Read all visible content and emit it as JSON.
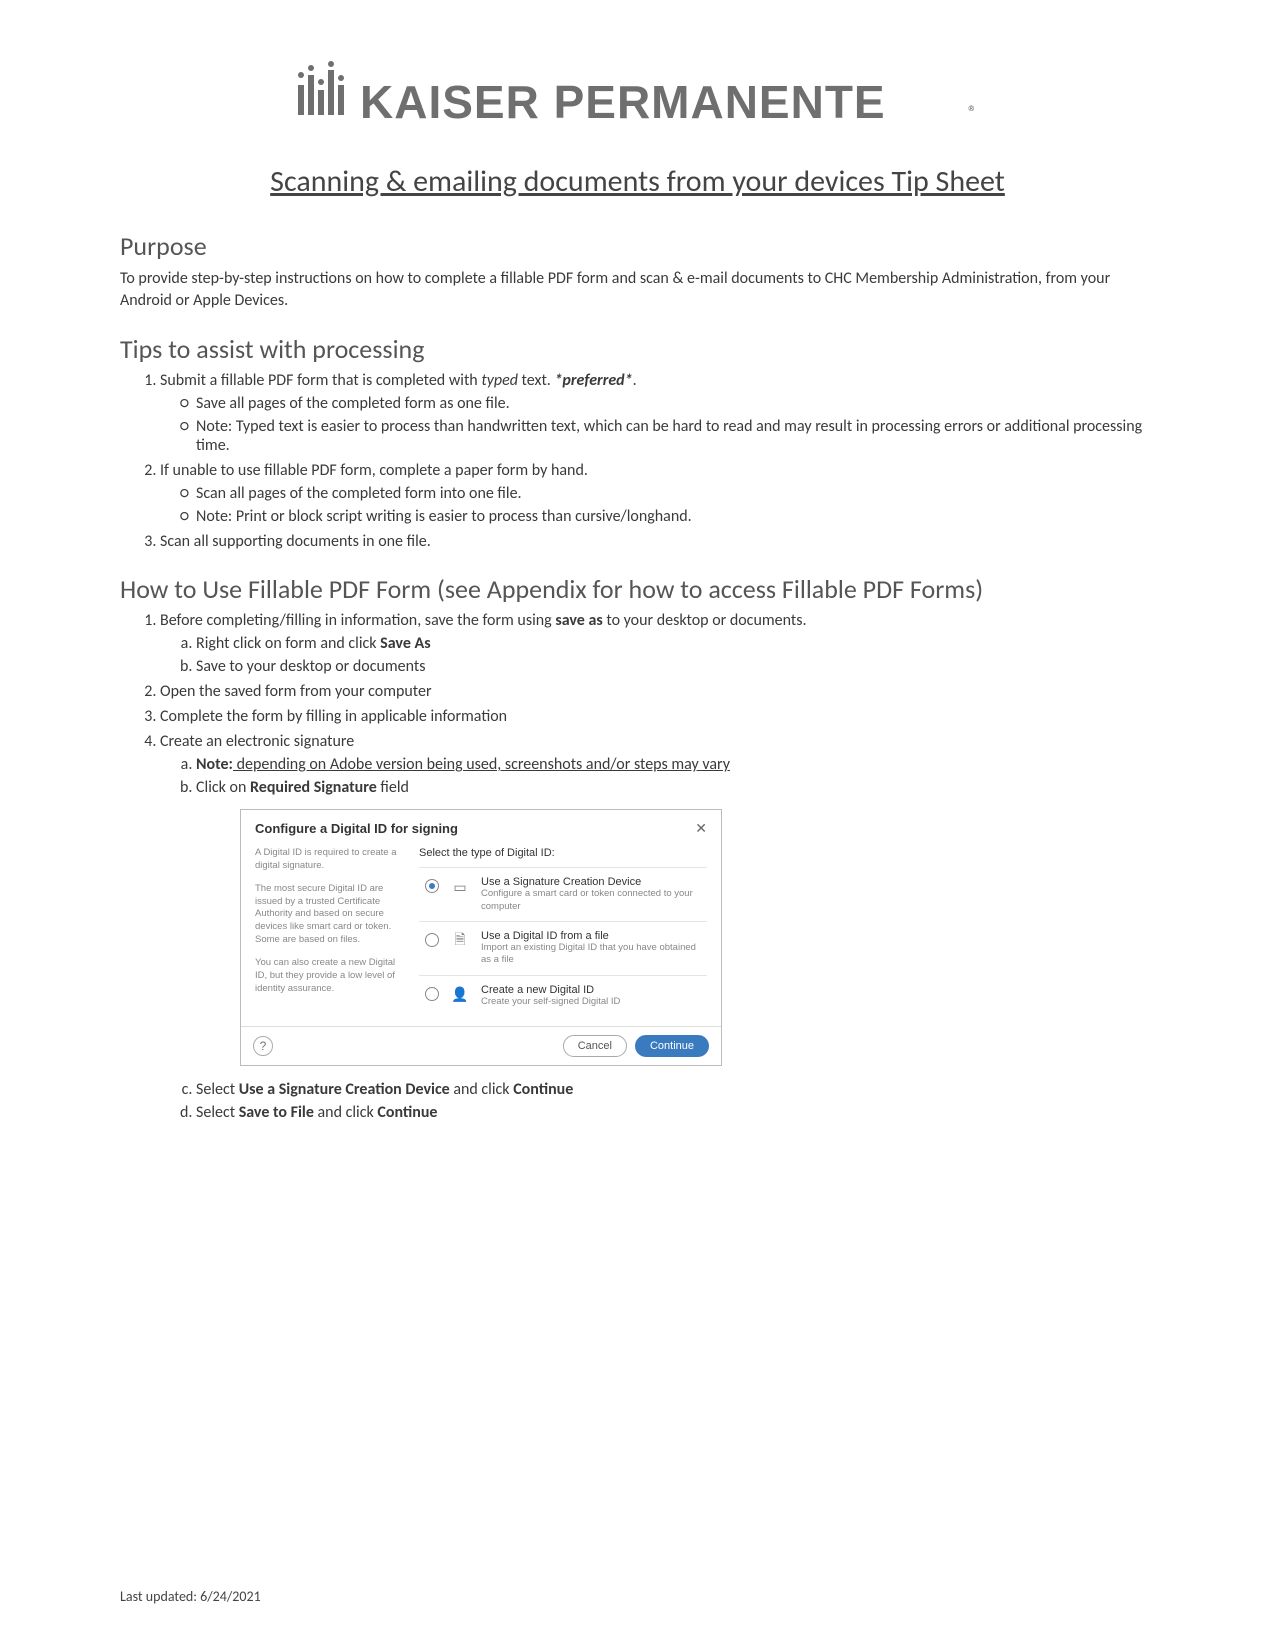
{
  "logo_text": "KAISER PERMANENTE®",
  "doc_title": "Scanning & emailing documents from your devices Tip Sheet",
  "purpose": {
    "heading": "Purpose",
    "body": "To provide step-by-step instructions on how to complete a fillable PDF form and scan & e-mail documents to CHC Membership Administration, from your Android or Apple Devices."
  },
  "tips": {
    "heading": "Tips to assist with processing",
    "items": [
      {
        "prefix": "Submit a fillable PDF form that is completed with ",
        "typed": "typed",
        "mid": " text. ",
        "preferred": "*preferred*",
        "suffix": ".",
        "sub": [
          "Save all pages of the completed form as one file.",
          "Note: Typed text is easier to process than handwritten text, which can be hard to read and may result in processing errors or additional processing time."
        ]
      },
      {
        "text": "If unable to use fillable PDF form, complete a paper form by hand.",
        "sub": [
          "Scan all pages of the completed form into one file.",
          "Note: Print or block script writing is easier to process than cursive/longhand."
        ]
      },
      {
        "text": "Scan all supporting documents in one file."
      }
    ]
  },
  "howto": {
    "heading": "How to Use Fillable PDF Form (see Appendix for how to access Fillable PDF Forms)",
    "step1": {
      "prefix": "Before completing/filling in information, save the form using ",
      "bold": "save as",
      "suffix": " to your desktop or documents.",
      "sub_a_prefix": "Right click on form and click ",
      "sub_a_bold": "Save As",
      "sub_b": "Save to your desktop or documents"
    },
    "step2": "Open the saved form from your computer",
    "step3": "Complete the form by filling in applicable information",
    "step4": {
      "text": "Create an electronic signature",
      "sub_a_prefix": "Note:",
      "sub_a_rest": " depending on Adobe version being used, screenshots and/or steps may vary",
      "sub_b_prefix": "Click on ",
      "sub_b_bold": "Required Signature",
      "sub_b_suffix": " field",
      "sub_c_prefix": "Select ",
      "sub_c_bold": "Use a Signature Creation Device",
      "sub_c_mid": " and click ",
      "sub_c_bold2": "Continue",
      "sub_d_prefix": "Select ",
      "sub_d_bold": "Save to File",
      "sub_d_mid": " and click ",
      "sub_d_bold2": "Continue"
    }
  },
  "dialog": {
    "title": "Configure a Digital ID for signing",
    "close": "✕",
    "left_p1": "A Digital ID is required to create a digital signature.",
    "left_p2": "The most secure Digital ID are issued by a trusted Certificate Authority and based on secure devices like smart card or token. Some are based on files.",
    "left_p3": "You can also create a new Digital ID, but they provide a low level of identity assurance.",
    "subtitle": "Select the type of Digital ID:",
    "options": [
      {
        "title": "Use a Signature Creation Device",
        "desc": "Configure a smart card or token connected to your computer"
      },
      {
        "title": "Use a Digital ID from a file",
        "desc": "Import an existing Digital ID that you have obtained as a file"
      },
      {
        "title": "Create a new Digital ID",
        "desc": "Create your self-signed Digital ID"
      }
    ],
    "help": "?",
    "cancel": "Cancel",
    "continue": "Continue"
  },
  "footer": "Last updated: 6/24/2021"
}
